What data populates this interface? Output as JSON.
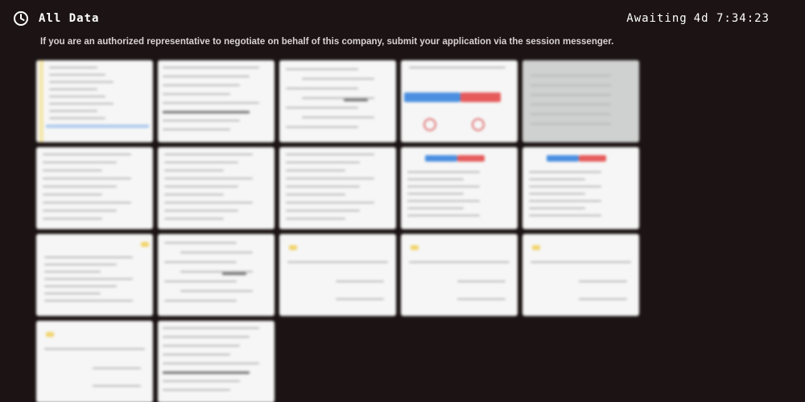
{
  "header": {
    "title": "All Data",
    "icon": "clock-icon",
    "status_label": "Awaiting",
    "countdown": "4d 7:34:23"
  },
  "notice": "If you are an authorized representative to negotiate on behalf of this company, submit your application via the session messenger.",
  "colors": {
    "background": "#1c1414",
    "text": "#ffffff",
    "thumbnail": "#f6f6f6"
  },
  "thumbnails": [
    {
      "kind": "sidebar-document"
    },
    {
      "kind": "table-document"
    },
    {
      "kind": "form-document"
    },
    {
      "kind": "logo-document"
    },
    {
      "kind": "screenshot-document"
    },
    {
      "kind": "text-document"
    },
    {
      "kind": "text-document"
    },
    {
      "kind": "list-document"
    },
    {
      "kind": "logo-letter-document"
    },
    {
      "kind": "logo-letter-document"
    },
    {
      "kind": "letter-document"
    },
    {
      "kind": "form-document"
    },
    {
      "kind": "signature-document"
    },
    {
      "kind": "signature-document"
    },
    {
      "kind": "signature-document"
    },
    {
      "kind": "signature-document"
    },
    {
      "kind": "table-document"
    }
  ]
}
